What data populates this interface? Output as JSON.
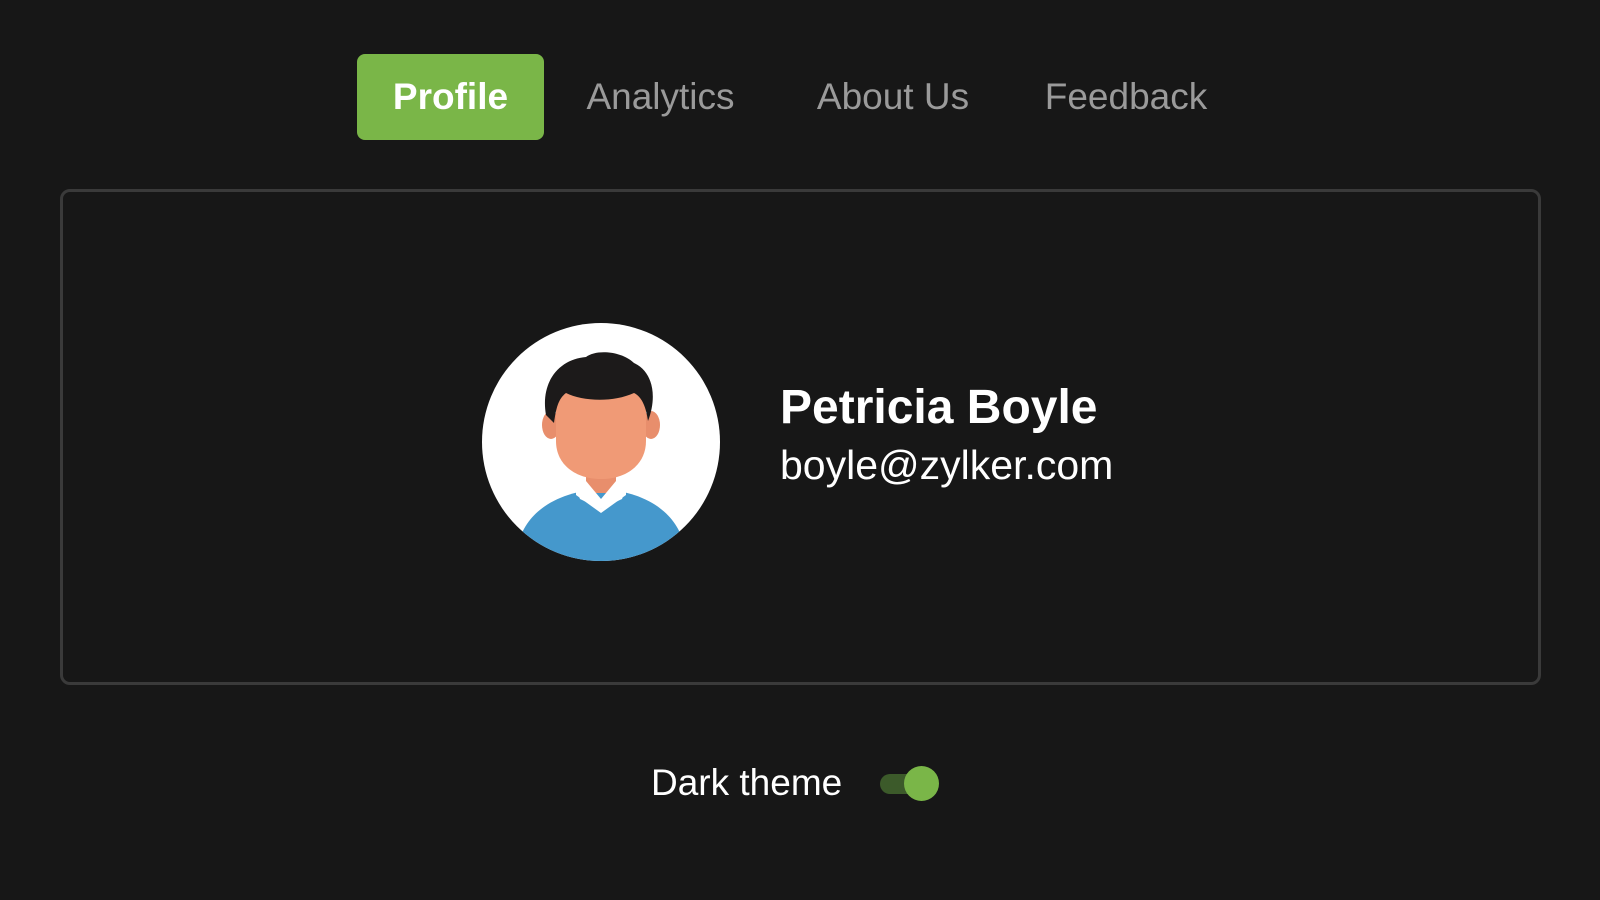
{
  "tabs": [
    {
      "label": "Profile",
      "active": true
    },
    {
      "label": "Analytics",
      "active": false
    },
    {
      "label": "About Us",
      "active": false
    },
    {
      "label": "Feedback",
      "active": false
    }
  ],
  "profile": {
    "name": "Petricia Boyle",
    "email": "boyle@zylker.com",
    "avatar_icon": "person-avatar-icon"
  },
  "theme": {
    "label": "Dark theme",
    "enabled": true
  },
  "colors": {
    "accent": "#7ab648",
    "background": "#171717",
    "card_border": "#3a3a3a",
    "inactive_tab_text": "#9a9a9a"
  }
}
